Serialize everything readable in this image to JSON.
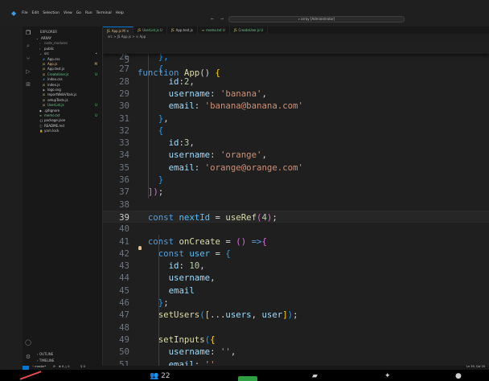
{
  "window": {
    "menu": [
      "File",
      "Edit",
      "Selection",
      "View",
      "Go",
      "Run",
      "Terminal",
      "Help"
    ],
    "nav_arrows": "← →",
    "command_center": "⌕ array [Administrator]"
  },
  "sidebar": {
    "title": "EXPLORER",
    "items": [
      {
        "label": "ARRAY",
        "icon": "chevron-down",
        "indent": 0,
        "color": "#cccccc",
        "badge": ""
      },
      {
        "label": "node_modules",
        "icon": "chevron-right",
        "indent": 1,
        "color": "#8b8b8b",
        "badge": ""
      },
      {
        "label": "public",
        "icon": "chevron-right",
        "indent": 1,
        "color": "#cccccc",
        "badge": ""
      },
      {
        "label": "src",
        "icon": "chevron-down",
        "indent": 1,
        "color": "#cccccc",
        "badge": "•"
      },
      {
        "label": "App.css",
        "icon": "#",
        "indent": 2,
        "color": "#cccccc",
        "badge": ""
      },
      {
        "label": "App.js",
        "icon": "JS",
        "indent": 2,
        "color": "#e2c08d",
        "badge": "M"
      },
      {
        "label": "App.test.js",
        "icon": "JS",
        "indent": 2,
        "color": "#cccccc",
        "badge": ""
      },
      {
        "label": "CreateUser.js",
        "icon": "JS",
        "indent": 2,
        "color": "#73c991",
        "badge": "U"
      },
      {
        "label": "index.css",
        "icon": "#",
        "indent": 2,
        "color": "#cccccc",
        "badge": ""
      },
      {
        "label": "index.js",
        "icon": "JS",
        "indent": 2,
        "color": "#cccccc",
        "badge": ""
      },
      {
        "label": "logo.svg",
        "icon": "◈",
        "indent": 2,
        "color": "#cccccc",
        "badge": ""
      },
      {
        "label": "reportWebVitals.js",
        "icon": "JS",
        "indent": 2,
        "color": "#cccccc",
        "badge": ""
      },
      {
        "label": "setupTests.js",
        "icon": "JS",
        "indent": 2,
        "color": "#cccccc",
        "badge": ""
      },
      {
        "label": "UserList.js",
        "icon": "JS",
        "indent": 2,
        "color": "#73c991",
        "badge": "U"
      },
      {
        "label": ".gitignore",
        "icon": "◆",
        "indent": 1,
        "color": "#cccccc",
        "badge": ""
      },
      {
        "label": "memo.txt",
        "icon": "≡",
        "indent": 1,
        "color": "#73c991",
        "badge": "U"
      },
      {
        "label": "package.json",
        "icon": "{}",
        "indent": 1,
        "color": "#cccccc",
        "badge": ""
      },
      {
        "label": "README.md",
        "icon": "ⓘ",
        "indent": 1,
        "color": "#cccccc",
        "badge": ""
      },
      {
        "label": "yarn.lock",
        "icon": "🔒",
        "indent": 1,
        "color": "#cccccc",
        "badge": ""
      }
    ],
    "outline": "OUTLINE",
    "timeline": "TIMELINE"
  },
  "tabs": [
    {
      "label": "App.js",
      "status": "M",
      "active": true,
      "color": "#e2c08d"
    },
    {
      "label": "UserList.js",
      "status": "U",
      "active": false,
      "color": "#73c991"
    },
    {
      "label": "App.test.js",
      "status": "",
      "active": false,
      "color": "#cccccc"
    },
    {
      "label": "memo.txt",
      "status": "U",
      "active": false,
      "color": "#73c991"
    },
    {
      "label": "CreateUser.js",
      "status": "U",
      "active": false,
      "color": "#73c991"
    }
  ],
  "breadcrumb": "src > JS App.js > ⊙ App",
  "editor": {
    "sticky": {
      "ln": "5",
      "tokens": [
        [
          "k",
          "function "
        ],
        [
          "fn",
          "App"
        ],
        [
          "p",
          "() "
        ],
        [
          "b1",
          "{"
        ]
      ]
    },
    "current_line": "39",
    "lines": [
      {
        "ln": "26",
        "tokens": [
          [
            "p",
            "    "
          ],
          [
            "b3",
            "},"
          ]
        ]
      },
      {
        "ln": "27",
        "tokens": [
          [
            "p",
            "    "
          ],
          [
            "b3",
            "{"
          ]
        ]
      },
      {
        "ln": "28",
        "tokens": [
          [
            "p",
            "      "
          ],
          [
            "v",
            "id"
          ],
          [
            "p",
            ":"
          ],
          [
            "n",
            "2"
          ],
          [
            "p",
            ","
          ]
        ]
      },
      {
        "ln": "29",
        "tokens": [
          [
            "p",
            "      "
          ],
          [
            "v",
            "username"
          ],
          [
            "p",
            ": "
          ],
          [
            "s",
            "'banana'"
          ],
          [
            "p",
            ","
          ]
        ]
      },
      {
        "ln": "30",
        "tokens": [
          [
            "p",
            "      "
          ],
          [
            "v",
            "email"
          ],
          [
            "p",
            ": "
          ],
          [
            "s",
            "'banana@banana.com'"
          ]
        ]
      },
      {
        "ln": "31",
        "tokens": [
          [
            "p",
            "    "
          ],
          [
            "b3",
            "}"
          ],
          [
            "p",
            ","
          ]
        ]
      },
      {
        "ln": "32",
        "tokens": [
          [
            "p",
            "    "
          ],
          [
            "b3",
            "{"
          ]
        ]
      },
      {
        "ln": "33",
        "tokens": [
          [
            "p",
            "      "
          ],
          [
            "v",
            "id"
          ],
          [
            "p",
            ":"
          ],
          [
            "n",
            "3"
          ],
          [
            "p",
            ","
          ]
        ]
      },
      {
        "ln": "34",
        "tokens": [
          [
            "p",
            "      "
          ],
          [
            "v",
            "username"
          ],
          [
            "p",
            ": "
          ],
          [
            "s",
            "'orange'"
          ],
          [
            "p",
            ","
          ]
        ]
      },
      {
        "ln": "35",
        "tokens": [
          [
            "p",
            "      "
          ],
          [
            "v",
            "email"
          ],
          [
            "p",
            ": "
          ],
          [
            "s",
            "'orange@orange.com'"
          ]
        ]
      },
      {
        "ln": "36",
        "tokens": [
          [
            "p",
            "    "
          ],
          [
            "b3",
            "}"
          ]
        ]
      },
      {
        "ln": "37",
        "tokens": [
          [
            "p",
            "  "
          ],
          [
            "b2",
            "]"
          ],
          [
            "b2",
            ")"
          ],
          [
            "p",
            ";"
          ]
        ]
      },
      {
        "ln": "38",
        "tokens": []
      },
      {
        "ln": "39",
        "tokens": [
          [
            "p",
            "  "
          ],
          [
            "k",
            "const "
          ],
          [
            "c",
            "nextId"
          ],
          [
            "p",
            " = "
          ],
          [
            "fn",
            "useRef"
          ],
          [
            "b2",
            "("
          ],
          [
            "n",
            "4"
          ],
          [
            "b2",
            ")"
          ],
          [
            "p",
            ";"
          ]
        ]
      },
      {
        "ln": "40",
        "tokens": []
      },
      {
        "ln": "41",
        "tokens": [
          [
            "p",
            "  "
          ],
          [
            "k",
            "const "
          ],
          [
            "fn",
            "onCreate"
          ],
          [
            "p",
            " = "
          ],
          [
            "b2",
            "()"
          ],
          [
            "p",
            " "
          ],
          [
            "k",
            "=>"
          ],
          [
            "b2",
            "{"
          ]
        ]
      },
      {
        "ln": "42",
        "tokens": [
          [
            "p",
            "    "
          ],
          [
            "k",
            "const "
          ],
          [
            "c",
            "user"
          ],
          [
            "p",
            " = "
          ],
          [
            "b3",
            "{"
          ]
        ]
      },
      {
        "ln": "43",
        "tokens": [
          [
            "p",
            "      "
          ],
          [
            "v",
            "id"
          ],
          [
            "p",
            ": "
          ],
          [
            "n",
            "10"
          ],
          [
            "p",
            ","
          ]
        ]
      },
      {
        "ln": "44",
        "tokens": [
          [
            "p",
            "      "
          ],
          [
            "v",
            "username"
          ],
          [
            "p",
            ","
          ]
        ]
      },
      {
        "ln": "45",
        "tokens": [
          [
            "p",
            "      "
          ],
          [
            "v",
            "email"
          ]
        ]
      },
      {
        "ln": "46",
        "tokens": [
          [
            "p",
            "    "
          ],
          [
            "b3",
            "}"
          ],
          [
            "p",
            ";"
          ]
        ]
      },
      {
        "ln": "47",
        "tokens": [
          [
            "p",
            "    "
          ],
          [
            "fn",
            "setUsers"
          ],
          [
            "b3",
            "("
          ],
          [
            "b1",
            "["
          ],
          [
            "p",
            "..."
          ],
          [
            "v",
            "users"
          ],
          [
            "p",
            ", "
          ],
          [
            "v",
            "user"
          ],
          [
            "b1",
            "]"
          ],
          [
            "b3",
            ")"
          ],
          [
            "p",
            ";"
          ]
        ]
      },
      {
        "ln": "48",
        "tokens": []
      },
      {
        "ln": "49",
        "tokens": [
          [
            "p",
            "    "
          ],
          [
            "fn",
            "setInputs"
          ],
          [
            "b3",
            "("
          ],
          [
            "b1",
            "{"
          ]
        ]
      },
      {
        "ln": "50",
        "tokens": [
          [
            "p",
            "      "
          ],
          [
            "v",
            "username"
          ],
          [
            "p",
            ": "
          ],
          [
            "s",
            "''"
          ],
          [
            "p",
            ","
          ]
        ]
      },
      {
        "ln": "51",
        "tokens": [
          [
            "p",
            "      "
          ],
          [
            "v",
            "email"
          ],
          [
            "p",
            ": "
          ],
          [
            "s",
            "''"
          ]
        ]
      }
    ]
  },
  "statusbar": {
    "branch": "master*",
    "sync": "⟳",
    "problems": "⊗ 0 △ 0",
    "ports": "⚲ 0",
    "position": "Ln 39, Col 20"
  },
  "dock": {
    "count_label": "22"
  },
  "colors": {
    "accent": "#0078d4",
    "modified": "#e2c08d",
    "untracked": "#73c991"
  }
}
